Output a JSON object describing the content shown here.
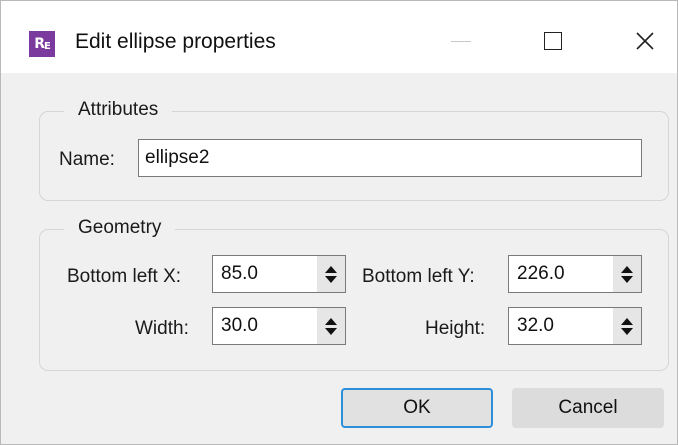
{
  "window": {
    "title": "Edit ellipse properties",
    "app_icon_text": "RE",
    "accent": "#7b3a9e"
  },
  "titlebar_controls": {
    "minimize": "minimize-icon",
    "maximize": "maximize-icon",
    "close": "close-icon"
  },
  "attributes": {
    "group_title": "Attributes",
    "name_label": "Name:",
    "name_value": "ellipse2"
  },
  "geometry": {
    "group_title": "Geometry",
    "bottom_left_x_label": "Bottom left X:",
    "bottom_left_x_value": "85.0",
    "bottom_left_y_label": "Bottom left Y:",
    "bottom_left_y_value": "226.0",
    "width_label": "Width:",
    "width_value": "30.0",
    "height_label": "Height:",
    "height_value": "32.0"
  },
  "buttons": {
    "ok": "OK",
    "cancel": "Cancel",
    "default_accent": "#2e8fd9"
  }
}
